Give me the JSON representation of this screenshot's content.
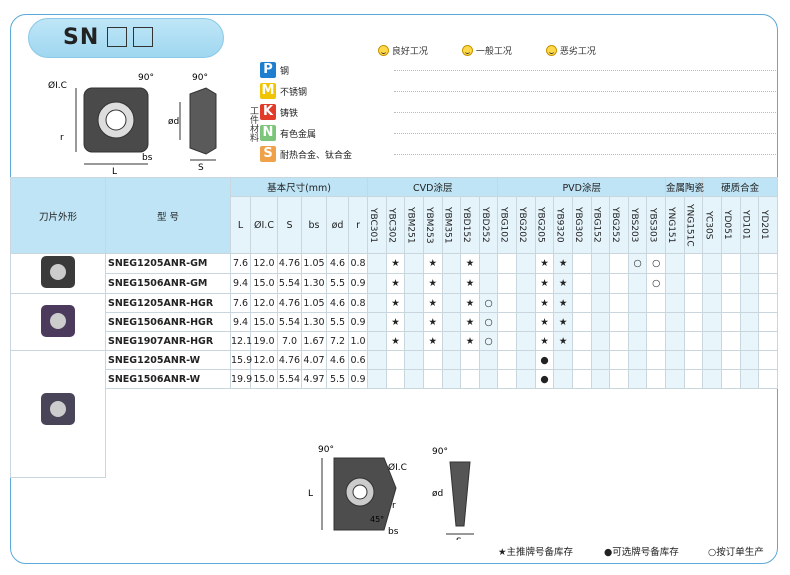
{
  "title": {
    "prefix": "SN"
  },
  "legend": [
    {
      "icon": "good-condition-smile",
      "text": "良好工况"
    },
    {
      "icon": "normal-condition-smile",
      "text": "一般工况"
    },
    {
      "icon": "bad-condition-smile",
      "text": "恶劣工况"
    }
  ],
  "workpiece": {
    "label": "工件材料",
    "rows": [
      {
        "letter": "P",
        "name": "钢",
        "color": "#1e7fd0"
      },
      {
        "letter": "M",
        "name": "不锈钢",
        "color": "#f0c400"
      },
      {
        "letter": "K",
        "name": "铸铁",
        "color": "#e23b2a"
      },
      {
        "letter": "N",
        "name": "有色金属",
        "color": "#7cc57a"
      },
      {
        "letter": "S",
        "name": "耐热合金、钛合金",
        "color": "#f0a24a"
      }
    ]
  },
  "diagram": {
    "l": "L",
    "ic": "ØI.C",
    "a90": "90°",
    "r": "r",
    "bs": "bs",
    "s": "S",
    "d": "ød",
    "a45": "45°"
  },
  "table": {
    "h_shape": "刀片外形",
    "h_model": "型 号",
    "h_dim": "基本尺寸(mm)",
    "h_cvd": "CVD涂层",
    "h_pvd": "PVD涂层",
    "h_cermet": "金属陶瓷",
    "h_carbide": "硬质合金",
    "dim_cols": [
      "L",
      "ØI.C",
      "S",
      "bs",
      "ød",
      "r"
    ],
    "grades": [
      "YBC301",
      "YBC302",
      "YBM251",
      "YBM253",
      "YBM351",
      "YBD152",
      "YBD252",
      "YBG102",
      "YBG202",
      "YBG205",
      "YB9320",
      "YBG302",
      "YBG152",
      "YBG252",
      "YBS203",
      "YBS303",
      "YNG151",
      "YNG151C",
      "YC30S",
      "YD051",
      "YD101",
      "YD201"
    ],
    "rows": [
      {
        "model": "SNEG1205ANR-GM",
        "dims": [
          "7.6",
          "12.0",
          "4.76",
          "1.05",
          "4.6",
          "0.8"
        ],
        "marks": {
          "1": "★",
          "3": "★",
          "5": "★",
          "9": "★",
          "10": "★",
          "14": "○",
          "15": "○"
        }
      },
      {
        "model": "SNEG1506ANR-GM",
        "dims": [
          "9.4",
          "15.0",
          "5.54",
          "1.30",
          "5.5",
          "0.9"
        ],
        "marks": {
          "1": "★",
          "3": "★",
          "5": "★",
          "9": "★",
          "10": "★",
          "15": "○"
        }
      },
      {
        "model": "SNEG1205ANR-HGR",
        "dims": [
          "7.6",
          "12.0",
          "4.76",
          "1.05",
          "4.6",
          "0.8"
        ],
        "marks": {
          "1": "★",
          "3": "★",
          "5": "★",
          "6": "○",
          "9": "★",
          "10": "★"
        }
      },
      {
        "model": "SNEG1506ANR-HGR",
        "dims": [
          "9.4",
          "15.0",
          "5.54",
          "1.30",
          "5.5",
          "0.9"
        ],
        "marks": {
          "1": "★",
          "3": "★",
          "5": "★",
          "6": "○",
          "9": "★",
          "10": "★"
        }
      },
      {
        "model": "SNEG1907ANR-HGR",
        "dims": [
          "12.1",
          "19.0",
          "7.0",
          "1.67",
          "7.2",
          "1.0"
        ],
        "marks": {
          "1": "★",
          "3": "★",
          "5": "★",
          "6": "○",
          "9": "★",
          "10": "★"
        }
      },
      {
        "model": "SNEG1205ANR-W",
        "dims": [
          "15.9",
          "12.0",
          "4.76",
          "4.07",
          "4.6",
          "0.6"
        ],
        "marks": {
          "9": "●"
        }
      },
      {
        "model": "SNEG1506ANR-W",
        "dims": [
          "19.9",
          "15.0",
          "5.54",
          "4.97",
          "5.5",
          "0.9"
        ],
        "marks": {
          "9": "●"
        }
      }
    ]
  },
  "footer": {
    "star": "★主推牌号备库存",
    "dot": "●可选牌号备库存",
    "ring": "○按订单生产"
  }
}
